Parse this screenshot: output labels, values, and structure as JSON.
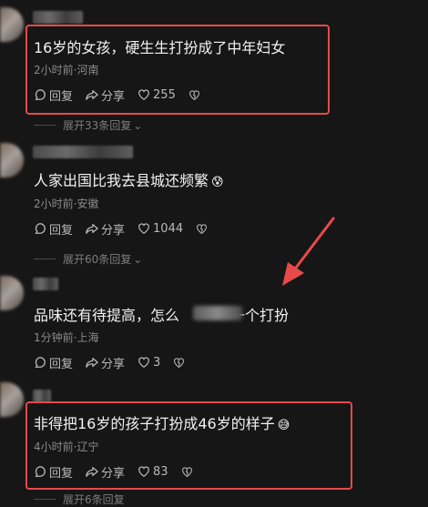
{
  "comments": [
    {
      "text": "16岁的女孩，硬生生打扮成了中年妇女",
      "emoji": "",
      "meta": "2小时前·河南",
      "reply_label": "回复",
      "share_label": "分享",
      "likes": "255",
      "expand": "展开33条回复"
    },
    {
      "text": "人家出国比我去县城还频繁",
      "emoji": "😰",
      "meta": "2小时前·安徽",
      "reply_label": "回复",
      "share_label": "分享",
      "likes": "1044",
      "expand": "展开60条回复"
    },
    {
      "text_a": "品味还有待提高，怎么",
      "text_b": "一个打扮",
      "meta": "1分钟前·上海",
      "reply_label": "回复",
      "share_label": "分享",
      "likes": "3"
    },
    {
      "text": "非得把16岁的孩子打扮成46岁的样子",
      "emoji": "😅",
      "meta": "4小时前·辽宁",
      "reply_label": "回复",
      "share_label": "分享",
      "likes": "83",
      "expand": "展开6条回复"
    }
  ],
  "colors": {
    "background": "#161616",
    "highlight": "#e74a4a",
    "arrow": "#e74a4a"
  },
  "icons": [
    "reply-icon",
    "share-icon",
    "heart-icon",
    "dislike-icon",
    "chevron-down-icon"
  ]
}
